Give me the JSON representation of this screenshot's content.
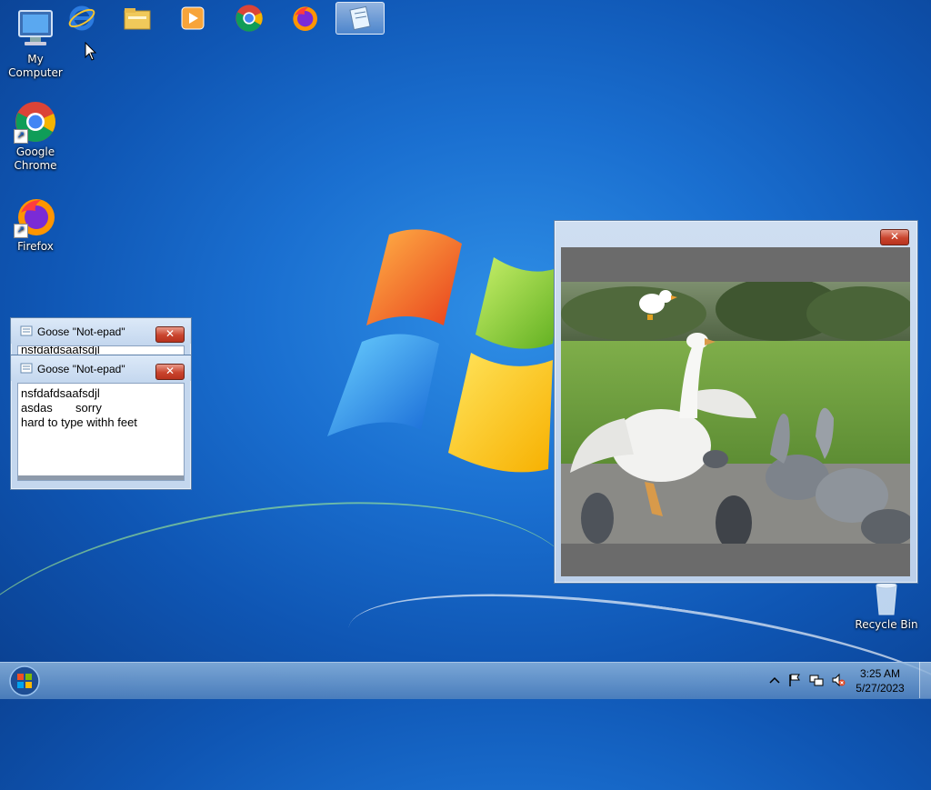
{
  "desktop": {
    "icons": [
      {
        "label": "My Computer",
        "icon": "computer-icon"
      },
      {
        "label": "Google\nChrome",
        "icon": "chrome-icon"
      },
      {
        "label": "Firefox",
        "icon": "firefox-icon"
      },
      {
        "label": "Recycle Bin",
        "icon": "recycle-bin-icon"
      }
    ]
  },
  "notepad_back": {
    "title": "Goose \"Not-epad\"",
    "partial_text": "nsfdafdsaafsdjl"
  },
  "notepad_front": {
    "title": "Goose \"Not-epad\"",
    "lines": [
      "nsfdafdsaafsdjl",
      "asdas       sorry",
      "hard to type withh feet"
    ]
  },
  "video_window": {
    "close_label": "✕",
    "content": "goose-with-pigeons-gif"
  },
  "taskbar": {
    "pinned": [
      "start-orb",
      "internet-explorer-icon",
      "file-explorer-icon",
      "media-player-icon",
      "chrome-icon",
      "firefox-icon",
      "notepad-icon"
    ],
    "clock_time": "3:25 AM",
    "clock_date": "5/27/2023"
  },
  "colors": {
    "close_red": "#c9442d",
    "window_frame": "#c4d7ee",
    "desktop_blue": "#1a6fd0"
  }
}
